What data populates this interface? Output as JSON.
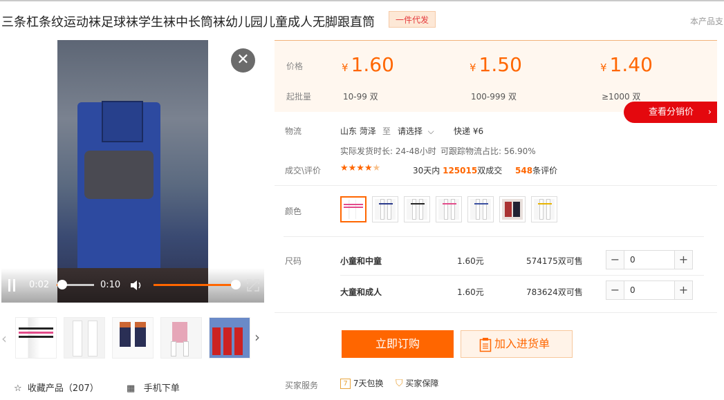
{
  "title": "三条杠条纹运动袜足球袜学生袜中长筒袜幼儿园儿童成人无脚跟直筒",
  "badge": "一件代发",
  "top_right": "本产品支",
  "video": {
    "current_time": "0:02",
    "duration": "0:10",
    "progress": 0.2,
    "volume": 1.0
  },
  "gallery": {
    "thumbs": [
      "thumb-1",
      "thumb-2",
      "thumb-3",
      "thumb-4",
      "thumb-5"
    ]
  },
  "bottom_left": {
    "favorite_label": "收藏产品（207）",
    "mobile_label": "手机下单"
  },
  "pricing": {
    "price_label": "价格",
    "qty_label": "起批量",
    "currency": "¥",
    "tiers": [
      {
        "price": "1.60",
        "qty": "10-99 双"
      },
      {
        "price": "1.50",
        "qty": "100-999 双"
      },
      {
        "price": "1.40",
        "qty": "≥1000 双"
      }
    ],
    "dist_button": "查看分销价"
  },
  "logistics": {
    "label": "物流",
    "from": "山东 菏泽",
    "to_word": "至",
    "select": "请选择",
    "express": "快递 ¥6",
    "ship_time": "实际发货时长: 24-48小时",
    "trace": "可跟踪物流占比: 56.90%"
  },
  "trade": {
    "label": "成交\\评价",
    "rating": 4.5,
    "days_prefix": "30天内",
    "deals": "125015",
    "deals_suffix": "双成交",
    "reviews": "548",
    "reviews_suffix": "条评价"
  },
  "color": {
    "label": "颜色",
    "swatches": [
      "sw1",
      "sw2",
      "sw3",
      "sw4",
      "sw5",
      "sw6",
      "sw7"
    ],
    "selected_index": 0
  },
  "size": {
    "label": "尺码",
    "rows": [
      {
        "name": "小童和中童",
        "price": "1.60元",
        "stock": "574175双可售",
        "qty": "0"
      },
      {
        "name": "大童和成人",
        "price": "1.60元",
        "stock": "783624双可售",
        "qty": "0"
      }
    ]
  },
  "actions": {
    "buy": "立即订购",
    "cart": "加入进货单"
  },
  "services": {
    "label": "买家服务",
    "items": [
      "7天包换",
      "买家保障"
    ]
  },
  "colors": {
    "accent": "#ff6600",
    "red": "#e4080e"
  }
}
